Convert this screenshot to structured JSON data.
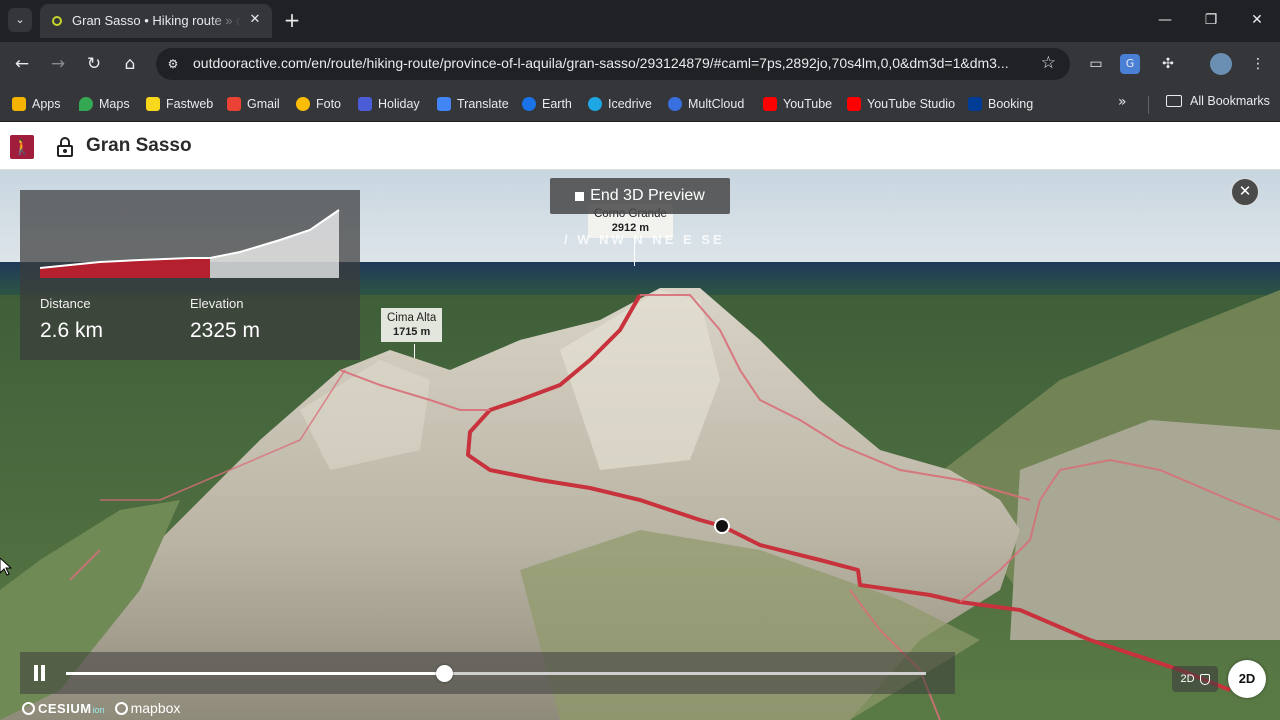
{
  "browser": {
    "tab_title": "Gran Sasso • Hiking route » outdooractive",
    "url": "outdooractive.com/en/route/hiking-route/province-of-l-aquila/gran-sasso/293124879/#caml=7ps,2892jo,70s4lm,0,0&dm3d=1&dm3...",
    "bookmarks": [
      {
        "label": "Apps",
        "icon": "apps-icon",
        "color": "#f4b400"
      },
      {
        "label": "Maps",
        "icon": "maps-icon",
        "color": "#34a853"
      },
      {
        "label": "Fastweb",
        "icon": "fastweb-icon",
        "color": "#f9d71c"
      },
      {
        "label": "Gmail",
        "icon": "gmail-icon",
        "color": "#ea4335"
      },
      {
        "label": "Foto",
        "icon": "photos-icon",
        "color": "#fbbc05"
      },
      {
        "label": "Holiday",
        "icon": "holiday-icon",
        "color": "#4a5cd6"
      },
      {
        "label": "Translate",
        "icon": "translate-icon",
        "color": "#4285f4"
      },
      {
        "label": "Earth",
        "icon": "earth-icon",
        "color": "#1a73e8"
      },
      {
        "label": "Icedrive",
        "icon": "icedrive-icon",
        "color": "#1ea7e4"
      },
      {
        "label": "MultCloud",
        "icon": "multcloud-icon",
        "color": "#3a6fe0"
      },
      {
        "label": "YouTube",
        "icon": "youtube-icon",
        "color": "#ff0000"
      },
      {
        "label": "YouTube Studio",
        "icon": "youtube-studio-icon",
        "color": "#ff0000"
      },
      {
        "label": "Booking",
        "icon": "booking-icon",
        "color": "#003b95"
      }
    ],
    "all_bookmarks": "All Bookmarks"
  },
  "page": {
    "title": "Gran Sasso",
    "accent": "#a01d3b"
  },
  "map": {
    "preview_button": "End 3D Preview",
    "stats": {
      "distance_label": "Distance",
      "distance_value": "2.6 km",
      "elevation_label": "Elevation",
      "elevation_value": "2325 m"
    },
    "peaks": [
      {
        "name": "Corno Grande",
        "elevation": "2912 m"
      },
      {
        "name": "Cima Alta",
        "elevation": "1715 m"
      }
    ],
    "compass": "/ W NW N NE E SE",
    "playback_progress": 0.44,
    "mode_chip": "2D",
    "mode_button": "2D",
    "attribution": {
      "cesium": "CESIUM",
      "ion": "ion",
      "mapbox": "mapbox"
    },
    "route_color": "#c8323c"
  }
}
